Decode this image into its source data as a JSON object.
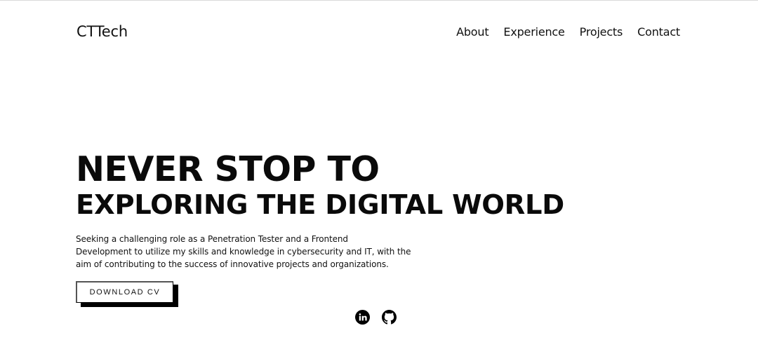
{
  "header": {
    "brand": "CTTech",
    "nav": [
      {
        "label": "About"
      },
      {
        "label": "Experience"
      },
      {
        "label": "Projects"
      },
      {
        "label": "Contact"
      }
    ]
  },
  "hero": {
    "title_line1": "NEVER STOP TO",
    "title_line2": "EXPLORING THE DIGITAL WORLD",
    "description_lines": [
      "Seeking a challenging role as a Penetration Tester and a Frontend",
      "Development to utilize my skills and knowledge in cybersecurity and IT, with the",
      "aim of contributing to the success of innovative projects and organizations."
    ],
    "cta_label": "DOWNLOAD CV"
  },
  "social": {
    "icons": [
      "linkedin-icon",
      "github-icon"
    ]
  },
  "colors": {
    "background": "#ffffff",
    "text": "#111111",
    "accent": "#000000"
  }
}
